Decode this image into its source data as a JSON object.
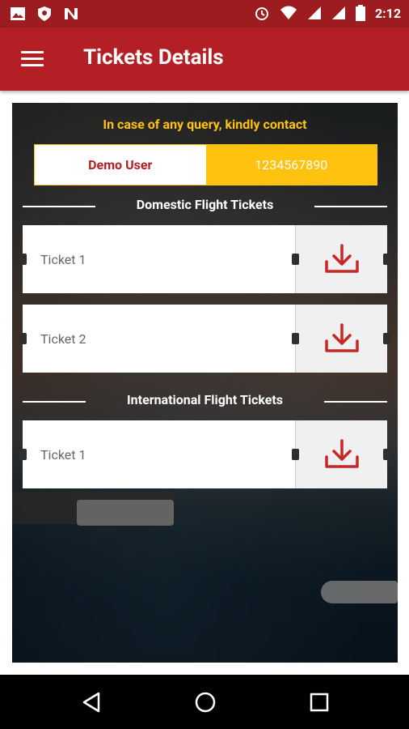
{
  "status_bar": {
    "time": "2:12",
    "icons": [
      "image-icon",
      "shield-icon",
      "n-icon",
      "alarm-icon",
      "wifi-icon",
      "signal-icon",
      "signal-icon",
      "battery-icon"
    ]
  },
  "app_bar": {
    "title": "Tickets Details",
    "menu_icon": "menu-icon"
  },
  "contact": {
    "query_text": "In case of any query, kindly contact",
    "name": "Demo User",
    "phone": "1234567890"
  },
  "sections": [
    {
      "title": "Domestic Flight Tickets",
      "tickets": [
        {
          "label": "Ticket 1"
        },
        {
          "label": "Ticket 2"
        }
      ]
    },
    {
      "title": "International Flight Tickets",
      "tickets": [
        {
          "label": "Ticket 1"
        }
      ]
    }
  ],
  "colors": {
    "primary_dark": "#9c1c20",
    "primary": "#b31f24",
    "accent": "#ffc20e",
    "download_icon": "#c62828"
  },
  "nav_bar": {
    "icons": [
      "back-icon",
      "home-icon",
      "recent-apps-icon"
    ]
  }
}
